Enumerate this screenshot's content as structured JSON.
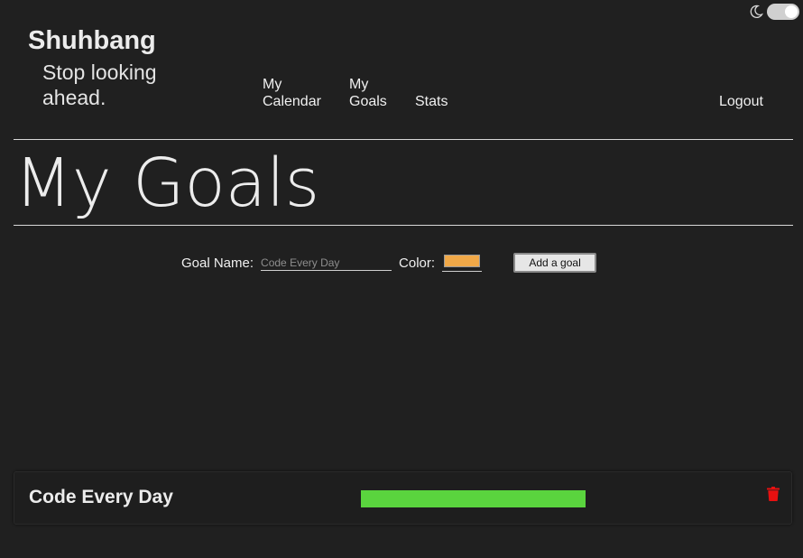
{
  "header": {
    "brand_name": "Shuhbang",
    "tagline": "Stop looking ahead.",
    "theme_toggle": {
      "icon": "moon-icon",
      "enabled": true
    }
  },
  "nav": {
    "calendar": "My Calendar",
    "goals": "My Goals",
    "stats": "Stats",
    "logout": "Logout"
  },
  "main": {
    "title": "My Goals",
    "form": {
      "goal_name_label": "Goal Name:",
      "goal_name_value": "",
      "goal_name_placeholder": "Code Every Day",
      "color_label": "Color:",
      "color_value": "#f0a848",
      "add_button_label": "Add a goal"
    },
    "goals": [
      {
        "name": "Code Every Day",
        "color": "#5ad43e",
        "progress": 1.0,
        "delete_icon": "trash-icon",
        "delete_color": "#e81010"
      }
    ]
  }
}
